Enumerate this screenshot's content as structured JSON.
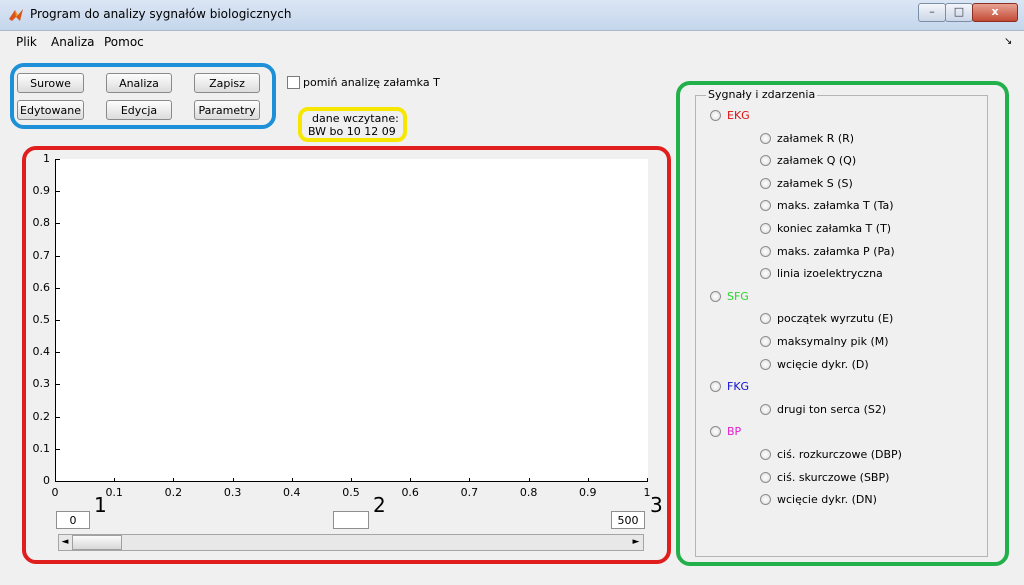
{
  "window": {
    "title": "Program do analizy sygnałów biologicznych",
    "min": "–",
    "max": "□",
    "close": "x"
  },
  "menu": {
    "items": [
      "Plik",
      "Analiza",
      "Pomoc"
    ],
    "arrow": "↘"
  },
  "buttons": {
    "surowe": "Surowe",
    "analiza": "Analiza",
    "zapisz": "Zapisz",
    "edytowane": "Edytowane",
    "edycja": "Edycja",
    "parametry": "Parametry"
  },
  "checkbox": {
    "label": "pomiń analizę załamka T",
    "checked": false
  },
  "loaded": {
    "label": "dane wczytane:",
    "value": "BW  bo  10  12  09"
  },
  "plot": {
    "yticks": [
      "1",
      "0.9",
      "0.8",
      "0.7",
      "0.6",
      "0.5",
      "0.4",
      "0.3",
      "0.2",
      "0.1",
      "0"
    ],
    "xticks": [
      "0",
      "0.1",
      "0.2",
      "0.3",
      "0.4",
      "0.5",
      "0.6",
      "0.7",
      "0.8",
      "0.9",
      "1"
    ]
  },
  "annotations": [
    "1",
    "2",
    "3"
  ],
  "controls": {
    "start": "0",
    "middle": "",
    "end": "500",
    "slider_left": "◄",
    "slider_right": "►"
  },
  "panel": {
    "title": "Sygnały i zdarzenia",
    "groups": [
      {
        "label": "EKG",
        "color": "#e01010",
        "items": [
          "załamek R (R)",
          "załamek Q (Q)",
          "załamek S (S)",
          "maks. załamka T (Ta)",
          "koniec załamka T (T)",
          "maks. załamka P (Pa)",
          "linia izoelektryczna"
        ]
      },
      {
        "label": "SFG",
        "color": "#2ad42a",
        "items": [
          "początek wyrzutu (E)",
          "maksymalny pik (M)",
          "wcięcie dykr. (D)"
        ]
      },
      {
        "label": "FKG",
        "color": "#1010d0",
        "items": [
          "drugi ton serca (S2)"
        ]
      },
      {
        "label": "BP",
        "color": "#e020d0",
        "items": [
          "ciś. rozkurczowe (DBP)",
          "ciś. skurczowe (SBP)",
          "wcięcie dykr. (DN)"
        ]
      }
    ]
  }
}
